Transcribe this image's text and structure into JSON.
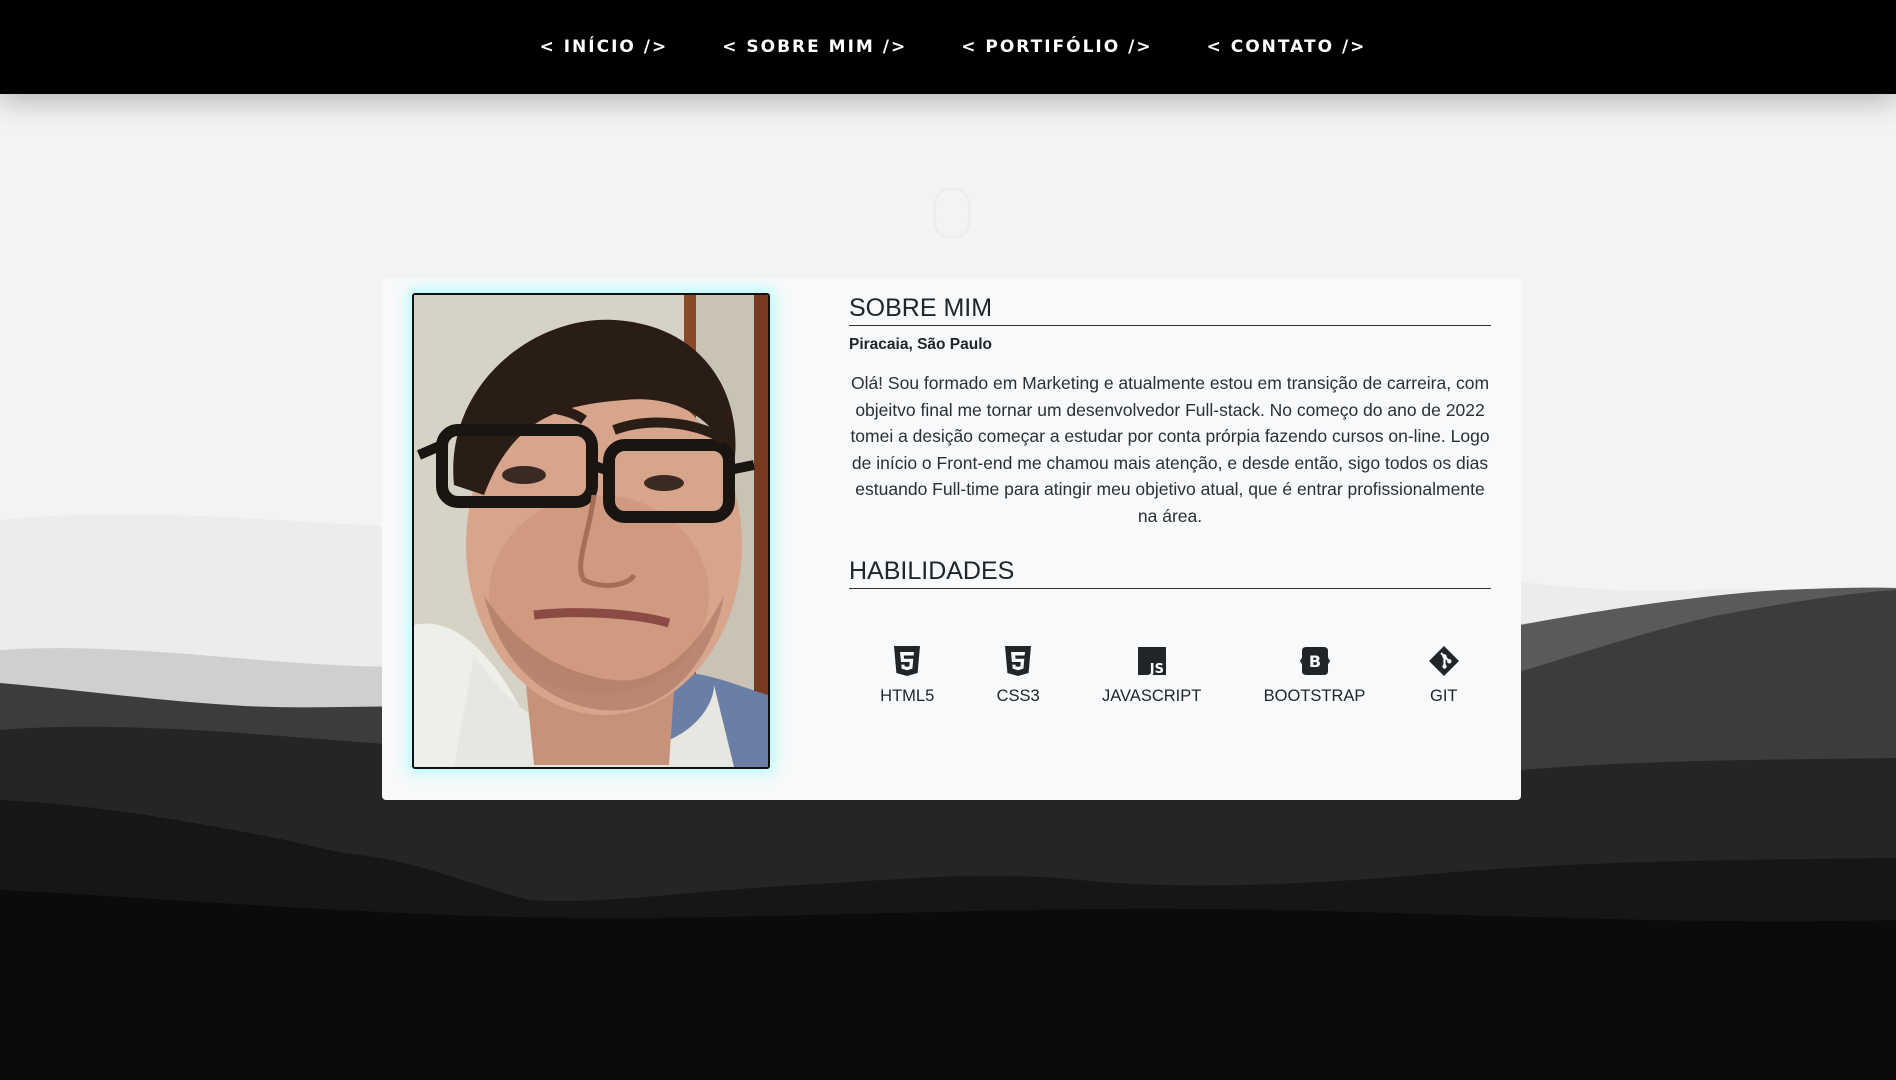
{
  "nav": {
    "items": [
      {
        "label": "< INÍCIO />"
      },
      {
        "label": "< SOBRE MIM />"
      },
      {
        "label": "< PORTIFÓLIO />"
      },
      {
        "label": "< CONTATO />"
      }
    ]
  },
  "about": {
    "title": "SOBRE MIM",
    "location": "Piracaia, São Paulo",
    "bio": "Olá! Sou formado em Marketing e atualmente estou em transição de carreira, com objeitvo final me tornar um desenvolvedor Full-stack. No começo do ano de 2022 tomei a desição começar a estudar por conta prórpia fazendo cursos on-line. Logo de início o Front-end me chamou mais atenção, e desde então, sigo todos os dias estuando Full-time para atingir meu objetivo atual, que é entrar profissionalmente na área."
  },
  "skills": {
    "title": "HABILIDADES",
    "items": [
      {
        "label": "HTML5",
        "icon": "html5-icon"
      },
      {
        "label": "CSS3",
        "icon": "css3-icon"
      },
      {
        "label": "JAVASCRIPT",
        "icon": "javascript-icon"
      },
      {
        "label": "BOOTSTRAP",
        "icon": "bootstrap-icon"
      },
      {
        "label": "GIT",
        "icon": "git-icon"
      }
    ]
  },
  "colors": {
    "nav_bg": "#000000",
    "card_bg": "#f8f9fa",
    "photo_glow": "#78ffff",
    "text": "#212529"
  }
}
